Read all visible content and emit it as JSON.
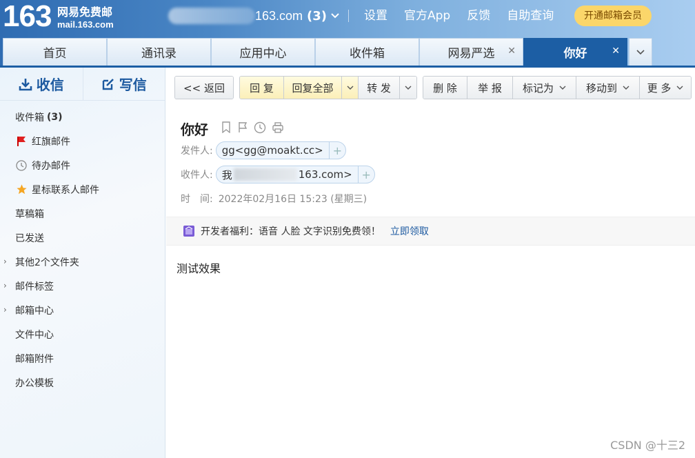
{
  "header": {
    "logo_number": "163",
    "logo_name": "网易免费邮",
    "logo_url": "mail.163.com",
    "account_domain": "163.com",
    "account_count": "(3)",
    "links": [
      "设置",
      "官方App",
      "反馈",
      "自助查询"
    ],
    "vip_button": "开通邮箱会员"
  },
  "tabs": [
    {
      "label": "首页",
      "closable": false
    },
    {
      "label": "通讯录",
      "closable": false
    },
    {
      "label": "应用中心",
      "closable": false
    },
    {
      "label": "收件箱",
      "closable": false
    },
    {
      "label": "网易严选",
      "closable": true
    },
    {
      "label": "你好",
      "closable": true,
      "active": true
    }
  ],
  "sidebar": {
    "receive_label": "收信",
    "write_label": "写信",
    "items": [
      {
        "label": "收件箱",
        "count": "(3)"
      },
      {
        "label": "红旗邮件",
        "icon": "red-flag-icon"
      },
      {
        "label": "待办邮件",
        "icon": "clock-icon"
      },
      {
        "label": "星标联系人邮件",
        "icon": "star-icon"
      },
      {
        "label": "草稿箱"
      },
      {
        "label": "已发送"
      },
      {
        "label": "其他2个文件夹",
        "expandable": true
      },
      {
        "label": "邮件标签",
        "expandable": true
      },
      {
        "label": "邮箱中心",
        "expandable": true
      },
      {
        "label": "文件中心"
      },
      {
        "label": "邮箱附件"
      },
      {
        "label": "办公模板"
      }
    ]
  },
  "toolbar": {
    "back": "<< 返回",
    "reply": "回 复",
    "reply_all": "回复全部",
    "forward": "转 发",
    "delete": "删 除",
    "report": "举 报",
    "mark_as": "标记为",
    "move_to": "移动到",
    "more": "更 多"
  },
  "mail": {
    "subject": "你好",
    "from_label": "发件人:",
    "from_value": "gg<gg@moakt.cc>",
    "to_label": "收件人:",
    "to_prefix": "我",
    "to_suffix": "163.com>",
    "time_label": "时　间:",
    "time_value": "2022年02月16日 15:23 (星期三)",
    "body": "测试效果"
  },
  "promo": {
    "text": "开发者福利：语音 人脸 文字识别免费领！",
    "link": "立即领取"
  },
  "watermark": "CSDN @十三2",
  "colors": {
    "brand_blue": "#1c5ea4",
    "vip_yellow": "#fbd66a",
    "flag_red": "#e02020",
    "star_yellow": "#f5a623"
  }
}
